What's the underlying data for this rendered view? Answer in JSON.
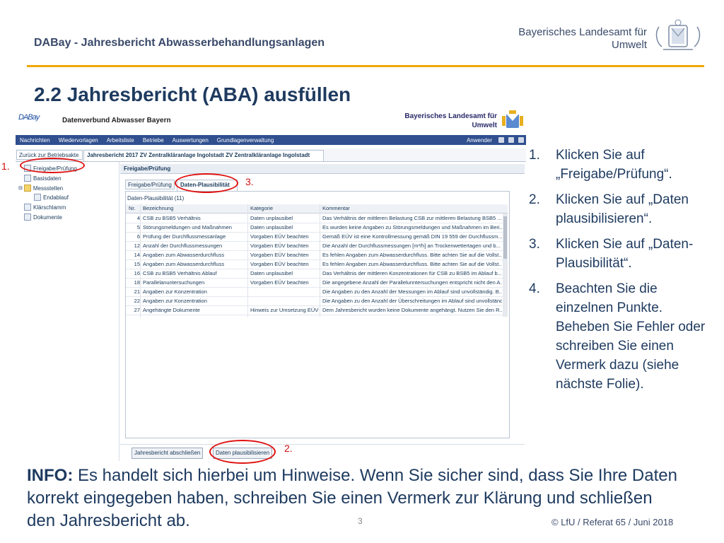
{
  "header": {
    "doc_title": "DABay - Jahresbericht Abwasserbehandlungsanlagen",
    "org_line1": "Bayerisches Landesamt für",
    "org_line2": "Umwelt",
    "crest_icon": "bavarian-crest-icon"
  },
  "slide_heading": "2.2 Jahresbericht (ABA) ausfüllen",
  "app": {
    "logo": "DABay",
    "title": "Datenverbund Abwasser Bayern",
    "org_line1": "Bayerisches Landesamt für",
    "org_line2": "Umwelt",
    "menu": [
      "Nachrichten",
      "Wiedervorlagen",
      "Arbeitsliste",
      "Betriebe",
      "Auswertungen",
      "Grundlagenverwaltung"
    ],
    "user_label": "Anwender",
    "back_tab": "Zurück zur Betriebsakte",
    "active_tab": "Jahresbericht 2017 ZV Zentralkläranlage Ingolstadt ZV Zentralkläranlage Ingolstadt",
    "tree": [
      {
        "label": "Freigabe/Prüfung",
        "indent": 0
      },
      {
        "label": "Basisdaten",
        "indent": 0
      },
      {
        "label": "Messstellen",
        "indent": 0
      },
      {
        "label": "Endablauf",
        "indent": 1
      },
      {
        "label": "Klärschlamm",
        "indent": 0
      },
      {
        "label": "Dokumente",
        "indent": 0
      }
    ],
    "panel_title": "Freigabe/Prüfung",
    "subtab1": "Freigabe/Prüfung",
    "subtab2": "Daten-Plausibilität",
    "grid_title": "Daten-Plausibilität  (11)",
    "columns": [
      "Nr.",
      "Bezeichnung",
      "Kategorie",
      "Kommentar"
    ],
    "rows": [
      {
        "nr": "4",
        "bez": "CSB zu BSB5 Verhältnis",
        "kat": "Daten unplausibel",
        "kom": "Das Verhältnis der mittleren Belastung CSB zur mittleren Belastung BSB5 ..."
      },
      {
        "nr": "5",
        "bez": "Störungsmeldungen und Maßnahmen",
        "kat": "Daten unplausibel",
        "kom": "Es wurden keine Angaben zu Störungsmeldungen und Maßnahmen im Beri..."
      },
      {
        "nr": "6",
        "bez": "Prüfung der Durchflussmessanlage",
        "kat": "Vorgaben EÜV beachten",
        "kom": "Gemäß EÜV ist eine Kontrollmessung gemäß DIN 19 559 der Durchflussm..."
      },
      {
        "nr": "12",
        "bez": "Anzahl der Durchflussmessungen",
        "kat": "Vorgaben EÜV beachten",
        "kom": "Die Anzahl der Durchflussmessungen [m³/h] an Trockenwettertagen und b..."
      },
      {
        "nr": "14",
        "bez": "Angaben zum Abwasserdurchfluss",
        "kat": "Vorgaben EÜV beachten",
        "kom": "Es fehlen Angaben zum Abwasserdurchfluss. Bitte achten Sie auf die Vollst..."
      },
      {
        "nr": "15",
        "bez": "Angaben zum Abwasserdurchfluss",
        "kat": "Vorgaben EÜV beachten",
        "kom": "Es fehlen Angaben zum Abwasserdurchfluss. Bitte achten Sie auf die Vollst..."
      },
      {
        "nr": "16",
        "bez": "CSB zu BSB5 Verhältnis Ablauf",
        "kat": "Daten unplausibel",
        "kom": "Das Verhältnis der mittleren Konzentrationen für CSB zu BSB5 im Ablauf b..."
      },
      {
        "nr": "18",
        "bez": "Parallelanuntersuchungen",
        "kat": "Vorgaben EÜV beachten",
        "kom": "Die angegebene Anzahl der Parallelunntersuchungen entspricht nicht den A..."
      },
      {
        "nr": "21",
        "bez": "Angaben zur Konzentration",
        "kat": "",
        "kom": "Die Angaben zu den Anzahl der Messungen im Ablauf sind unvollständig. B..."
      },
      {
        "nr": "22",
        "bez": "Angaben zur Konzentration",
        "kat": "",
        "kom": "Die Angaben zu den Anzahl der Überschreitungen im Ablauf sind unvollständig..."
      },
      {
        "nr": "27",
        "bez": "Angehängte Dokumente",
        "kat": "Hinweis zur Umsetzung EÜV",
        "kom": "Dem Jahresbericht wurden keine Dokumente angehängt. Nutzen Sie den R..."
      }
    ],
    "btn_finish": "Jahresbericht abschließen",
    "btn_plaus": "Daten plausibilisieren"
  },
  "markers": {
    "m1": "1.",
    "m2": "2.",
    "m3": "3."
  },
  "steps": [
    {
      "num": "1.",
      "text": "Klicken Sie auf „Freigabe/Prüfung“."
    },
    {
      "num": "2.",
      "text": "Klicken Sie auf „Daten plausibilisieren“."
    },
    {
      "num": "3.",
      "text": "Klicken Sie auf „Daten-Plausibilität“."
    },
    {
      "num": "4.",
      "text": "Beachten Sie die einzelnen Punkte. Beheben Sie Fehler oder schreiben Sie einen Vermerk dazu (siehe nächste Folie)."
    }
  ],
  "info": {
    "label": "INFO:",
    "text": " Es handelt sich hierbei um Hinweise. Wenn Sie sicher sind, dass Sie Ihre Daten korrekt eingegeben haben, schreiben Sie einen Vermerk zur Klärung und schließen den Jahresbericht ab."
  },
  "footer": "© LfU / Referat 65 / Juni 2018",
  "page_number": "3",
  "colors": {
    "accent": "#f0a800",
    "menu": "#2f4f8f",
    "highlight": "#e01010",
    "text": "#1e3a5f"
  }
}
